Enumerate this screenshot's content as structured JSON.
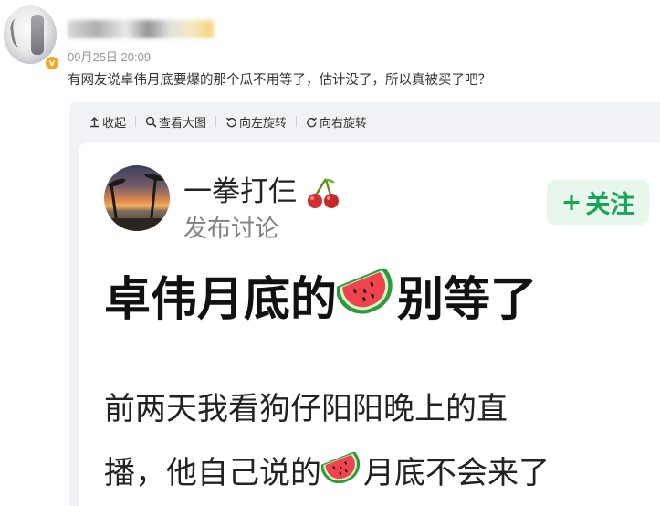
{
  "post": {
    "time": "09月25日 20:09",
    "text": "有网友说卓伟月底要爆的那个瓜不用等了，估计没了，所以真被买了吧？",
    "verified_badge": "v"
  },
  "toolbar": {
    "collapse": "收起",
    "view_large": "查看大图",
    "rotate_left": "向左旋转",
    "rotate_right": "向右旋转"
  },
  "screenshot": {
    "author_name": "一拳打仨",
    "author_sub": "发布讨论",
    "follow_label": "关注",
    "follow_plus": "+",
    "headline_before": "卓伟月底的",
    "headline_after": "别等了",
    "body_line1": "前两天我看狗仔阳阳晚上的直",
    "body_line2_before": "播，他自己说的",
    "body_line2_after": "月底不会来了"
  },
  "icons": {
    "collapse": "arrow-up-icon",
    "view_large": "magnifier-icon",
    "rotate_left": "rotate-left-icon",
    "rotate_right": "rotate-right-icon",
    "emoji_name": "cherries-icon",
    "emoji_headline": "watermelon-icon"
  },
  "colors": {
    "follow_green": "#1aa35a",
    "follow_bg": "#e8f7ec",
    "badge_orange": "#f5a623"
  }
}
